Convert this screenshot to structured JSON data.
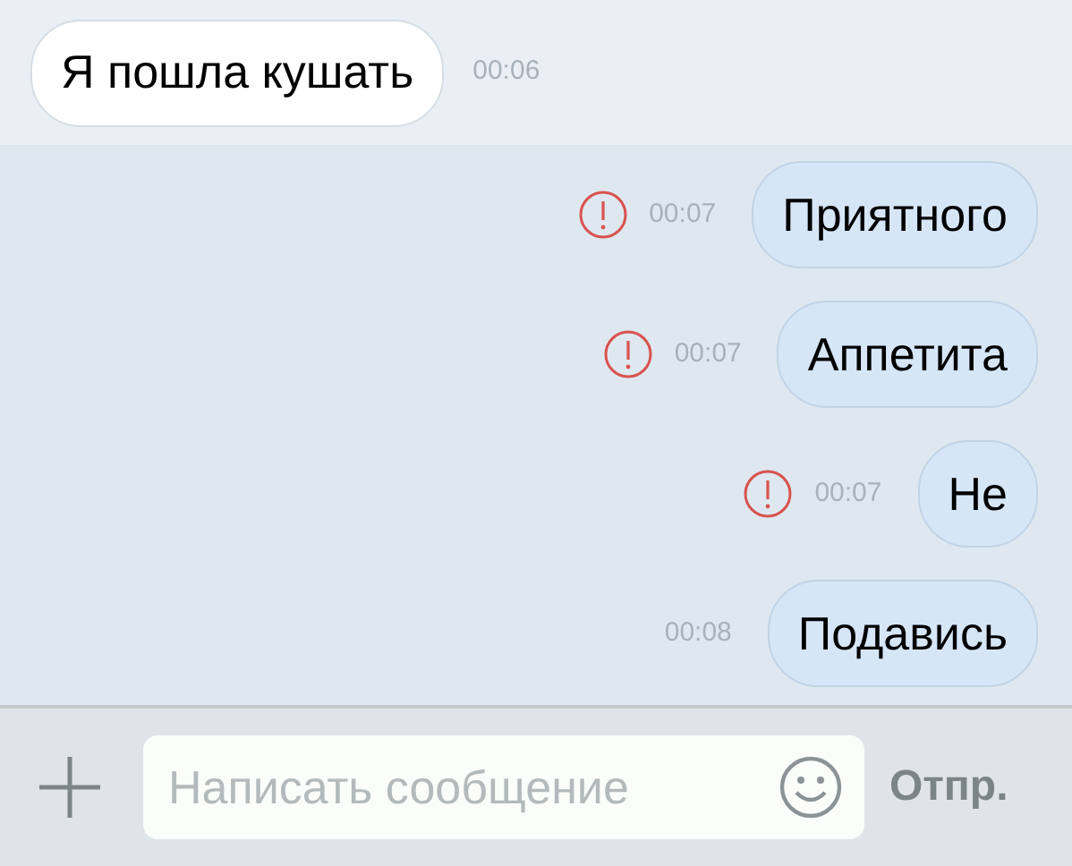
{
  "messages": [
    {
      "kind": "incoming",
      "text": "Я пошла кушать",
      "time": "00:06",
      "failed": false
    },
    {
      "kind": "outgoing",
      "text": "Приятного",
      "time": "00:07",
      "failed": true
    },
    {
      "kind": "outgoing",
      "text": "Аппетита",
      "time": "00:07",
      "failed": true
    },
    {
      "kind": "outgoing",
      "text": "Не",
      "time": "00:07",
      "failed": true
    },
    {
      "kind": "outgoing",
      "text": "Подавись",
      "time": "00:08",
      "failed": false
    }
  ],
  "composer": {
    "placeholder": "Написать сообщение",
    "send_label": "Отпр."
  }
}
